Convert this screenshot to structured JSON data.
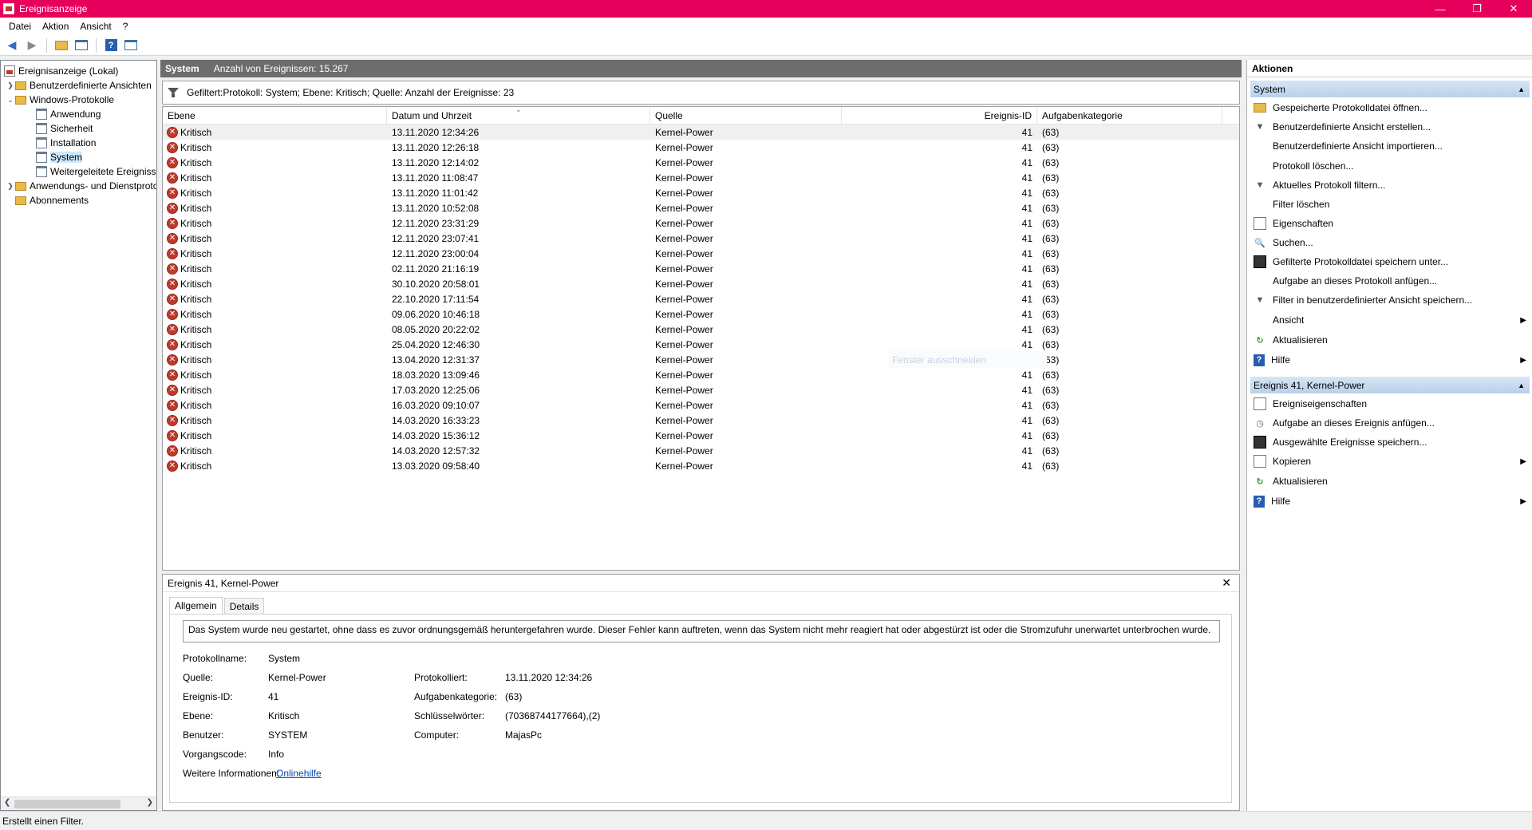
{
  "window": {
    "title": "Ereignisanzeige",
    "minimize": "—",
    "restore": "❐",
    "close": "✕"
  },
  "menu": [
    "Datei",
    "Aktion",
    "Ansicht",
    "?"
  ],
  "tree": {
    "root": "Ereignisanzeige (Lokal)",
    "custom_views": "Benutzerdefinierte Ansichten",
    "windows_logs": "Windows-Protokolle",
    "logs": [
      "Anwendung",
      "Sicherheit",
      "Installation",
      "System",
      "Weitergeleitete Ereignisse"
    ],
    "app_service_logs": "Anwendungs- und Dienstprotokolle",
    "subscriptions": "Abonnements"
  },
  "center": {
    "title": "System",
    "count_text": "Anzahl von Ereignissen: 15.267",
    "filter_text": "Gefiltert:Protokoll: System; Ebene: Kritisch; Quelle:  Anzahl der Ereignisse: 23",
    "ghost_tip": "Fenster ausschneiden"
  },
  "table": {
    "columns": [
      "Ebene",
      "Datum und Uhrzeit",
      "Quelle",
      "Ereignis-ID",
      "Aufgabenkategorie"
    ],
    "rows": [
      {
        "level": "Kritisch",
        "date": "13.11.2020 12:34:26",
        "source": "Kernel-Power",
        "id": "41",
        "cat": "(63)"
      },
      {
        "level": "Kritisch",
        "date": "13.11.2020 12:26:18",
        "source": "Kernel-Power",
        "id": "41",
        "cat": "(63)"
      },
      {
        "level": "Kritisch",
        "date": "13.11.2020 12:14:02",
        "source": "Kernel-Power",
        "id": "41",
        "cat": "(63)"
      },
      {
        "level": "Kritisch",
        "date": "13.11.2020 11:08:47",
        "source": "Kernel-Power",
        "id": "41",
        "cat": "(63)"
      },
      {
        "level": "Kritisch",
        "date": "13.11.2020 11:01:42",
        "source": "Kernel-Power",
        "id": "41",
        "cat": "(63)"
      },
      {
        "level": "Kritisch",
        "date": "13.11.2020 10:52:08",
        "source": "Kernel-Power",
        "id": "41",
        "cat": "(63)"
      },
      {
        "level": "Kritisch",
        "date": "12.11.2020 23:31:29",
        "source": "Kernel-Power",
        "id": "41",
        "cat": "(63)"
      },
      {
        "level": "Kritisch",
        "date": "12.11.2020 23:07:41",
        "source": "Kernel-Power",
        "id": "41",
        "cat": "(63)"
      },
      {
        "level": "Kritisch",
        "date": "12.11.2020 23:00:04",
        "source": "Kernel-Power",
        "id": "41",
        "cat": "(63)"
      },
      {
        "level": "Kritisch",
        "date": "02.11.2020 21:16:19",
        "source": "Kernel-Power",
        "id": "41",
        "cat": "(63)"
      },
      {
        "level": "Kritisch",
        "date": "30.10.2020 20:58:01",
        "source": "Kernel-Power",
        "id": "41",
        "cat": "(63)"
      },
      {
        "level": "Kritisch",
        "date": "22.10.2020 17:11:54",
        "source": "Kernel-Power",
        "id": "41",
        "cat": "(63)"
      },
      {
        "level": "Kritisch",
        "date": "09.06.2020 10:46:18",
        "source": "Kernel-Power",
        "id": "41",
        "cat": "(63)"
      },
      {
        "level": "Kritisch",
        "date": "08.05.2020 20:22:02",
        "source": "Kernel-Power",
        "id": "41",
        "cat": "(63)"
      },
      {
        "level": "Kritisch",
        "date": "25.04.2020 12:46:30",
        "source": "Kernel-Power",
        "id": "41",
        "cat": "(63)"
      },
      {
        "level": "Kritisch",
        "date": "13.04.2020 12:31:37",
        "source": "Kernel-Power",
        "id": "41",
        "cat": "(63)"
      },
      {
        "level": "Kritisch",
        "date": "18.03.2020 13:09:46",
        "source": "Kernel-Power",
        "id": "41",
        "cat": "(63)"
      },
      {
        "level": "Kritisch",
        "date": "17.03.2020 12:25:06",
        "source": "Kernel-Power",
        "id": "41",
        "cat": "(63)"
      },
      {
        "level": "Kritisch",
        "date": "16.03.2020 09:10:07",
        "source": "Kernel-Power",
        "id": "41",
        "cat": "(63)"
      },
      {
        "level": "Kritisch",
        "date": "14.03.2020 16:33:23",
        "source": "Kernel-Power",
        "id": "41",
        "cat": "(63)"
      },
      {
        "level": "Kritisch",
        "date": "14.03.2020 15:36:12",
        "source": "Kernel-Power",
        "id": "41",
        "cat": "(63)"
      },
      {
        "level": "Kritisch",
        "date": "14.03.2020 12:57:32",
        "source": "Kernel-Power",
        "id": "41",
        "cat": "(63)"
      },
      {
        "level": "Kritisch",
        "date": "13.03.2020 09:58:40",
        "source": "Kernel-Power",
        "id": "41",
        "cat": "(63)"
      }
    ]
  },
  "detail": {
    "title": "Ereignis 41, Kernel-Power",
    "close": "✕",
    "tabs": [
      "Allgemein",
      "Details"
    ],
    "description": "Das System wurde neu gestartet, ohne dass es zuvor ordnungsgemäß heruntergefahren wurde. Dieser Fehler kann auftreten, wenn das System nicht mehr reagiert hat oder abgestürzt ist oder die Stromzufuhr unerwartet unterbrochen wurde.",
    "protokollname_label": "Protokollname:",
    "protokollname": "System",
    "quelle_label": "Quelle:",
    "quelle": "Kernel-Power",
    "protokolliert_label": "Protokolliert:",
    "protokolliert": "13.11.2020 12:34:26",
    "id_label": "Ereignis-ID:",
    "id": "41",
    "kategorie_label": "Aufgabenkategorie:",
    "kategorie": "(63)",
    "ebene_label": "Ebene:",
    "ebene": "Kritisch",
    "keywords_label": "Schlüsselwörter:",
    "keywords": "(70368744177664),(2)",
    "benutzer_label": "Benutzer:",
    "benutzer": "SYSTEM",
    "computer_label": "Computer:",
    "computer": "MajasPc",
    "opcode_label": "Vorgangscode:",
    "opcode": "Info",
    "more_label": "Weitere Informationen:",
    "more_link": "Onlinehilfe"
  },
  "actions": {
    "title": "Aktionen",
    "section1": "System",
    "items1": [
      "Gespeicherte Protokolldatei öffnen...",
      "Benutzerdefinierte Ansicht erstellen...",
      "Benutzerdefinierte Ansicht importieren...",
      "Protokoll löschen...",
      "Aktuelles Protokoll filtern...",
      "Filter löschen",
      "Eigenschaften",
      "Suchen...",
      "Gefilterte Protokolldatei speichern unter...",
      "Aufgabe an dieses Protokoll anfügen...",
      "Filter in benutzerdefinierter Ansicht speichern...",
      "Ansicht",
      "Aktualisieren",
      "Hilfe"
    ],
    "section2": "Ereignis 41, Kernel-Power",
    "items2": [
      "Ereigniseigenschaften",
      "Aufgabe an dieses Ereignis anfügen...",
      "Ausgewählte Ereignisse speichern...",
      "Kopieren",
      "Aktualisieren",
      "Hilfe"
    ]
  },
  "status": "Erstellt einen Filter."
}
